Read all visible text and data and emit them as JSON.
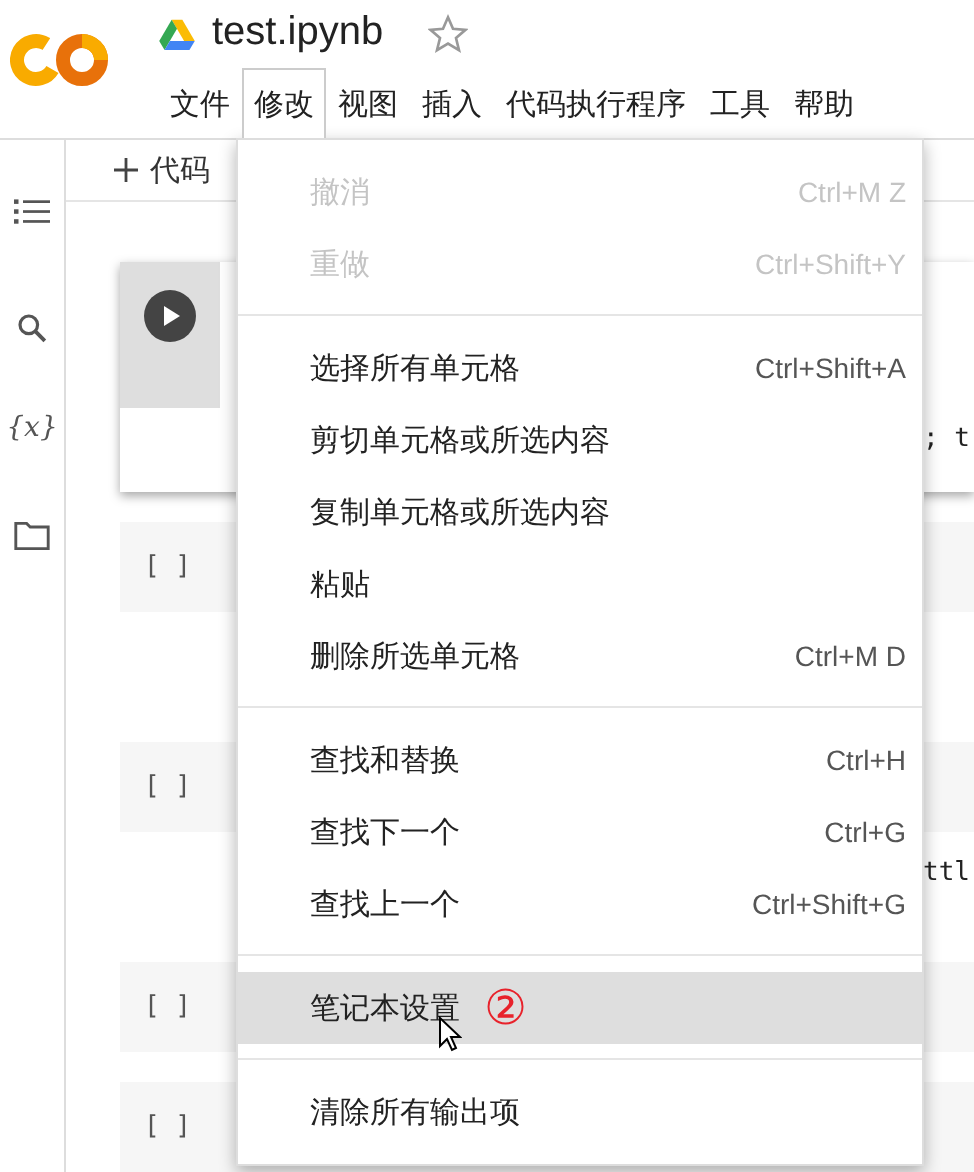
{
  "header": {
    "title": "test.ipynb",
    "starred": false
  },
  "menubar": [
    {
      "label": "文件",
      "selected": false
    },
    {
      "label": "修改",
      "selected": true
    },
    {
      "label": "视图",
      "selected": false
    },
    {
      "label": "插入",
      "selected": false
    },
    {
      "label": "代码执行程序",
      "selected": false
    },
    {
      "label": "工具",
      "selected": false
    },
    {
      "label": "帮助",
      "selected": false
    }
  ],
  "toolbar": {
    "add_code": "代码"
  },
  "sidebar": {
    "variables_icon": "{x}"
  },
  "cells": [
    {
      "kind": "run",
      "code_line": "; t"
    },
    {
      "kind": "empty",
      "prompt": "[ ]"
    },
    {
      "kind": "empty",
      "prompt": "[ ]",
      "code_line": "ttl"
    },
    {
      "kind": "empty",
      "prompt": "[ ]"
    },
    {
      "kind": "empty",
      "prompt": "[ ]"
    }
  ],
  "edit_menu": [
    {
      "kind": "item",
      "label": "撤消",
      "shortcut": "Ctrl+M Z",
      "disabled": true,
      "selected": false
    },
    {
      "kind": "item",
      "label": "重做",
      "shortcut": "Ctrl+Shift+Y",
      "disabled": true,
      "selected": false
    },
    {
      "kind": "divider"
    },
    {
      "kind": "item",
      "label": "选择所有单元格",
      "shortcut": "Ctrl+Shift+A",
      "disabled": false,
      "selected": false
    },
    {
      "kind": "item",
      "label": "剪切单元格或所选内容",
      "disabled": false,
      "selected": false
    },
    {
      "kind": "item",
      "label": "复制单元格或所选内容",
      "disabled": false,
      "selected": false
    },
    {
      "kind": "item",
      "label": "粘贴",
      "disabled": false,
      "selected": false
    },
    {
      "kind": "item",
      "label": "删除所选单元格",
      "shortcut": "Ctrl+M D",
      "disabled": false,
      "selected": false
    },
    {
      "kind": "divider"
    },
    {
      "kind": "item",
      "label": "查找和替换",
      "shortcut": "Ctrl+H",
      "disabled": false,
      "selected": false
    },
    {
      "kind": "item",
      "label": "查找下一个",
      "shortcut": "Ctrl+G",
      "disabled": false,
      "selected": false
    },
    {
      "kind": "item",
      "label": "查找上一个",
      "shortcut": "Ctrl+Shift+G",
      "disabled": false,
      "selected": false
    },
    {
      "kind": "divider"
    },
    {
      "kind": "item",
      "label": "笔记本设置",
      "disabled": false,
      "selected": true,
      "annotation": "②"
    },
    {
      "kind": "divider"
    },
    {
      "kind": "item",
      "label": "清除所有输出项",
      "disabled": false,
      "selected": false
    }
  ]
}
